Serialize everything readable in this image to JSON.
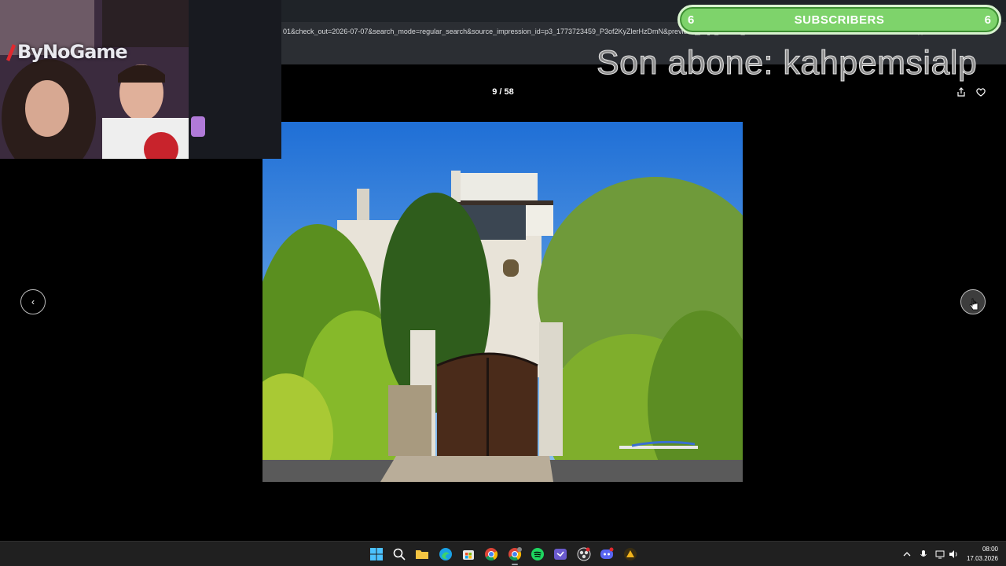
{
  "browser": {
    "address_text": "01&check_out=2026-07-07&search_mode=regular_search&source_impression_id=p3_1773723459_P3of2KyZlerHzDmN&previous_page_section_name"
  },
  "viewer": {
    "counter": "9 / 58",
    "prev_icon": "chevron-left",
    "next_icon": "chevron-right",
    "share_icon": "share",
    "save_icon": "heart"
  },
  "overlay": {
    "webcam_logo": "ByNoGame",
    "subscribers": {
      "count_left": "6",
      "label": "SUBSCRIBERS",
      "count_right": "6",
      "accent": "#7ed36b"
    },
    "last_subscriber": "Son abone: kahpemsialp"
  },
  "taskbar": {
    "apps": [
      "windows-start",
      "search",
      "file-explorer",
      "edge",
      "microsoft-store",
      "chrome",
      "chrome-profile",
      "spotify",
      "streamer-app",
      "obs",
      "discord",
      "warning-app"
    ],
    "time": "08:00",
    "date": "17.03.2026"
  }
}
